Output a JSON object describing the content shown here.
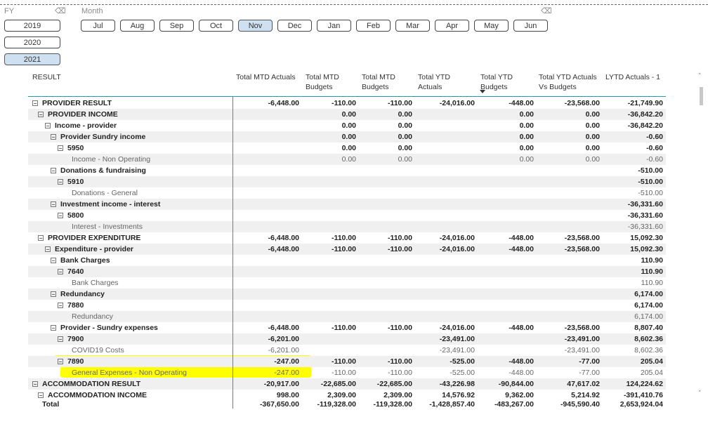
{
  "slicers": {
    "fy": {
      "title": "FY",
      "options": [
        "2019",
        "2020",
        "2021"
      ],
      "selected": "2021"
    },
    "month": {
      "title": "Month",
      "options": [
        "Jul",
        "Aug",
        "Sep",
        "Oct",
        "Nov",
        "Dec",
        "Jan",
        "Feb",
        "Mar",
        "Apr",
        "May",
        "Jun"
      ],
      "selected": "Nov"
    }
  },
  "table": {
    "headers": {
      "result": "RESULT",
      "mtd_actuals": "Total MTD Actuals",
      "mtd_budgets_1": "Total MTD\nBudgets",
      "mtd_budgets_2": "Total MTD\nBudgets",
      "ytd_actuals": "Total YTD\nActuals",
      "ytd_budgets": "Total YTD\nBudgets",
      "ytd_vs": "Total YTD Actuals\nVs Budgets",
      "lytd": "LYTD Actuals - 1"
    },
    "rows": [
      {
        "label": "PROVIDER RESULT",
        "level": 0,
        "bold": true,
        "toggle": "⊟",
        "shade": false,
        "v": [
          "-6,448.00",
          "-110.00",
          "-110.00",
          "-24,016.00",
          "-448.00",
          "-23,568.00",
          "-21,749.90"
        ]
      },
      {
        "label": "PROVIDER INCOME",
        "level": 1,
        "bold": true,
        "toggle": "⊟",
        "shade": true,
        "v": [
          "",
          "0.00",
          "0.00",
          "",
          "0.00",
          "0.00",
          "-36,842.20"
        ]
      },
      {
        "label": "Income - provider",
        "level": 2,
        "bold": true,
        "toggle": "⊟",
        "shade": false,
        "v": [
          "",
          "0.00",
          "0.00",
          "",
          "0.00",
          "0.00",
          "-36,842.20"
        ]
      },
      {
        "label": "Provider Sundry income",
        "level": 3,
        "bold": true,
        "toggle": "⊟",
        "shade": true,
        "v": [
          "",
          "0.00",
          "0.00",
          "",
          "0.00",
          "0.00",
          "-0.60"
        ]
      },
      {
        "label": "5950",
        "level": 4,
        "bold": true,
        "toggle": "⊟",
        "shade": false,
        "v": [
          "",
          "0.00",
          "0.00",
          "",
          "0.00",
          "0.00",
          "-0.60"
        ]
      },
      {
        "label": "Income - Non Operating",
        "level": 5,
        "bold": false,
        "toggle": "",
        "shade": true,
        "v": [
          "",
          "0.00",
          "0.00",
          "",
          "0.00",
          "0.00",
          "-0.60"
        ]
      },
      {
        "label": "Donations & fundraising",
        "level": 3,
        "bold": true,
        "toggle": "⊟",
        "shade": false,
        "v": [
          "",
          "",
          "",
          "",
          "",
          "",
          "-510.00"
        ]
      },
      {
        "label": "5910",
        "level": 4,
        "bold": true,
        "toggle": "⊟",
        "shade": true,
        "v": [
          "",
          "",
          "",
          "",
          "",
          "",
          "-510.00"
        ]
      },
      {
        "label": "Donations - General",
        "level": 5,
        "bold": false,
        "toggle": "",
        "shade": false,
        "v": [
          "",
          "",
          "",
          "",
          "",
          "",
          "-510.00"
        ]
      },
      {
        "label": "Investment income - interest",
        "level": 3,
        "bold": true,
        "toggle": "⊟",
        "shade": true,
        "v": [
          "",
          "",
          "",
          "",
          "",
          "",
          "-36,331.60"
        ]
      },
      {
        "label": "5800",
        "level": 4,
        "bold": true,
        "toggle": "⊟",
        "shade": false,
        "v": [
          "",
          "",
          "",
          "",
          "",
          "",
          "-36,331.60"
        ]
      },
      {
        "label": "Interest - Investments",
        "level": 5,
        "bold": false,
        "toggle": "",
        "shade": true,
        "v": [
          "",
          "",
          "",
          "",
          "",
          "",
          "-36,331.60"
        ]
      },
      {
        "label": "PROVIDER EXPENDITURE",
        "level": 1,
        "bold": true,
        "toggle": "⊟",
        "shade": false,
        "v": [
          "-6,448.00",
          "-110.00",
          "-110.00",
          "-24,016.00",
          "-448.00",
          "-23,568.00",
          "15,092.30"
        ]
      },
      {
        "label": "Expenditure - provider",
        "level": 2,
        "bold": true,
        "toggle": "⊟",
        "shade": true,
        "v": [
          "-6,448.00",
          "-110.00",
          "-110.00",
          "-24,016.00",
          "-448.00",
          "-23,568.00",
          "15,092.30"
        ]
      },
      {
        "label": "Bank Charges",
        "level": 3,
        "bold": true,
        "toggle": "⊟",
        "shade": false,
        "v": [
          "",
          "",
          "",
          "",
          "",
          "",
          "110.90"
        ]
      },
      {
        "label": "7640",
        "level": 4,
        "bold": true,
        "toggle": "⊟",
        "shade": true,
        "v": [
          "",
          "",
          "",
          "",
          "",
          "",
          "110.90"
        ]
      },
      {
        "label": "Bank Charges",
        "level": 5,
        "bold": false,
        "toggle": "",
        "shade": false,
        "v": [
          "",
          "",
          "",
          "",
          "",
          "",
          "110.90"
        ]
      },
      {
        "label": "Redundancy",
        "level": 3,
        "bold": true,
        "toggle": "⊟",
        "shade": true,
        "v": [
          "",
          "",
          "",
          "",
          "",
          "",
          "6,174.00"
        ]
      },
      {
        "label": "7880",
        "level": 4,
        "bold": true,
        "toggle": "⊟",
        "shade": false,
        "v": [
          "",
          "",
          "",
          "",
          "",
          "",
          "6,174.00"
        ]
      },
      {
        "label": "Redundancy",
        "level": 5,
        "bold": false,
        "toggle": "",
        "shade": true,
        "v": [
          "",
          "",
          "",
          "",
          "",
          "",
          "6,174.00"
        ]
      },
      {
        "label": "Provider - Sundry expenses",
        "level": 3,
        "bold": true,
        "toggle": "⊟",
        "shade": false,
        "v": [
          "-6,448.00",
          "-110.00",
          "-110.00",
          "-24,016.00",
          "-448.00",
          "-23,568.00",
          "8,807.40"
        ]
      },
      {
        "label": "7900",
        "level": 4,
        "bold": true,
        "toggle": "⊟",
        "shade": true,
        "v": [
          "-6,201.00",
          "",
          "",
          "-23,491.00",
          "",
          "-23,491.00",
          "8,602.36"
        ]
      },
      {
        "label": "COVID19 Costs",
        "level": 5,
        "bold": false,
        "toggle": "",
        "shade": false,
        "v": [
          "-6,201.00",
          "",
          "",
          "-23,491.00",
          "",
          "-23,491.00",
          "8,602.36"
        ]
      },
      {
        "label": "7890",
        "level": 4,
        "bold": true,
        "toggle": "⊟",
        "shade": true,
        "highlight": true,
        "v": [
          "-247.00",
          "-110.00",
          "-110.00",
          "-525.00",
          "-448.00",
          "-77.00",
          "205.04"
        ]
      },
      {
        "label": "General Expenses - Non Operating",
        "level": 5,
        "bold": false,
        "toggle": "",
        "shade": false,
        "highlight": true,
        "v": [
          "-247.00",
          "-110.00",
          "-110.00",
          "-525.00",
          "-448.00",
          "-77.00",
          "205.04"
        ]
      },
      {
        "label": "ACCOMMODATION RESULT",
        "level": 0,
        "bold": true,
        "toggle": "⊟",
        "shade": true,
        "v": [
          "-20,917.00",
          "-22,685.00",
          "-22,685.00",
          "-43,226.98",
          "-90,844.00",
          "47,617.02",
          "124,224.62"
        ]
      },
      {
        "label": "ACCOMMODATION INCOME",
        "level": 1,
        "bold": true,
        "toggle": "⊟",
        "shade": false,
        "v": [
          "998.00",
          "2,309.00",
          "2,309.00",
          "14,576.92",
          "9,362.00",
          "5,214.92",
          "-391,410.76"
        ]
      }
    ],
    "total": {
      "label": "Total",
      "v": [
        "-367,650.00",
        "-119,328.00",
        "-119,328.00",
        "-1,428,857.40",
        "-483,267.00",
        "-945,590.40",
        "2,653,924.04"
      ]
    }
  },
  "colors": {
    "accent": "#1f9ea6",
    "selected": "#cfe0f1",
    "highlight": "#ffff00"
  },
  "icons": {
    "eraser": "eraser-icon",
    "expand": "collapse-toggle-icon",
    "sort": "sort-descending-icon",
    "scroll_up": "chevron-up-icon",
    "scroll_down": "chevron-down-icon"
  }
}
